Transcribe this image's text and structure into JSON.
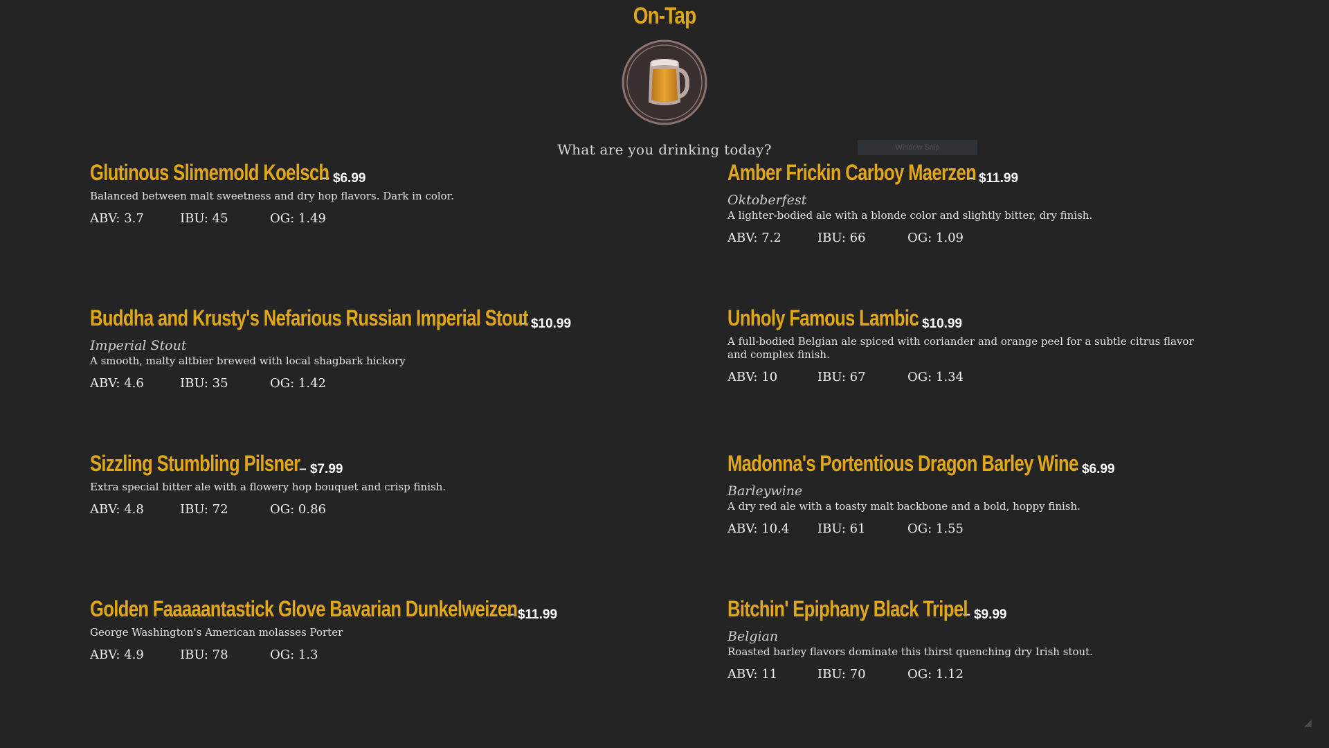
{
  "header": {
    "title": "On-Tap",
    "logo_icon": "beer-mug-icon",
    "tagline": "What are you drinking today?"
  },
  "overlay": {
    "window_snip_label": "Window Snip"
  },
  "colors": {
    "background": "#242424",
    "accent": "#e0a818",
    "text": "#e8e8e8"
  },
  "beers": [
    {
      "name": "Glutinous Slimemold Koelsch",
      "price": "– $6.99",
      "style": "",
      "description": "Balanced between malt sweetness and dry hop flavors. Dark in color.",
      "abv": "ABV: 3.7",
      "ibu": "IBU: 45",
      "og": "OG: 1.49"
    },
    {
      "name": "Amber Frickin Carboy Maerzen",
      "price": "– $11.99",
      "style": "Oktoberfest",
      "description": "A lighter-bodied ale with a blonde color and slightly bitter, dry finish.",
      "abv": "ABV: 7.2",
      "ibu": "IBU: 66",
      "og": "OG: 1.09"
    },
    {
      "name": "Buddha and Krusty's Nefarious Russian Imperial Stout",
      "price": "– $10.99",
      "style": "Imperial Stout",
      "description": "A smooth, malty altbier brewed with local shagbark hickory",
      "abv": "ABV: 4.6",
      "ibu": "IBU: 35",
      "og": "OG: 1.42"
    },
    {
      "name": "Unholy Famous Lambic",
      "price": "– $10.99",
      "style": "",
      "description": "A full-bodied Belgian ale spiced with coriander and orange peel for a subtle citrus flavor and complex finish.",
      "abv": "ABV: 10",
      "ibu": "IBU: 67",
      "og": "OG: 1.34"
    },
    {
      "name": "Sizzling Stumbling Pilsner",
      "price": "– $7.99",
      "style": "",
      "description": "Extra special bitter ale with a flowery hop bouquet and crisp finish.",
      "abv": "ABV: 4.8",
      "ibu": "IBU: 72",
      "og": "OG: 0.86"
    },
    {
      "name": "Madonna's Portentious Dragon Barley Wine",
      "price": "– $6.99",
      "style": "Barleywine",
      "description": "A dry red ale with a toasty malt backbone and a bold, hoppy finish.",
      "abv": "ABV: 10.4",
      "ibu": "IBU: 61",
      "og": "OG: 1.55"
    },
    {
      "name": "Golden Faaaaantastick Glove Bavarian Dunkelweizen",
      "price": "– $11.99",
      "style": "",
      "description": "George Washington's American molasses Porter",
      "abv": "ABV: 4.9",
      "ibu": "IBU: 78",
      "og": "OG: 1.3"
    },
    {
      "name": "Bitchin' Epiphany Black Tripel",
      "price": "– $9.99",
      "style": "Belgian",
      "description": "Roasted barley flavors dominate this thirst quenching dry Irish stout.",
      "abv": "ABV: 11",
      "ibu": "IBU: 70",
      "og": "OG: 1.12"
    }
  ]
}
